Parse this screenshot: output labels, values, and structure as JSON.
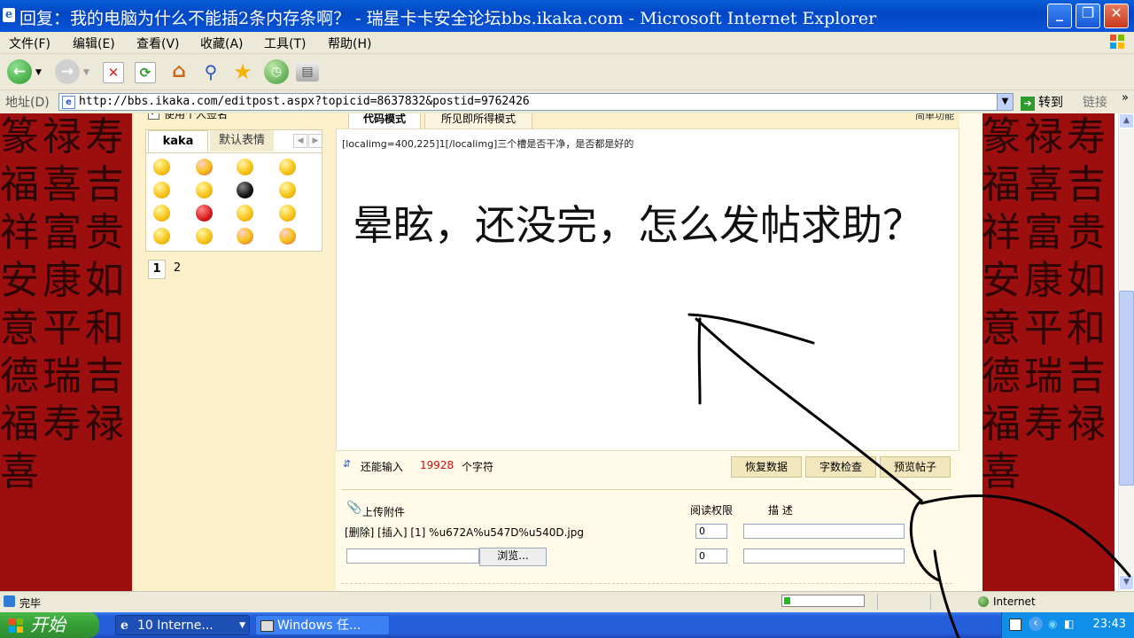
{
  "window": {
    "title": "回复：我的电脑为什么不能插2条内存条啊？ - 瑞星卡卡安全论坛bbs.ikaka.com - Microsoft Internet Explorer",
    "minimize": "_",
    "maximize": "❐",
    "close": "✕",
    "ie_icon": "e"
  },
  "menu": [
    "文件(F)",
    "编辑(E)",
    "查看(V)",
    "收藏(A)",
    "工具(T)",
    "帮助(H)"
  ],
  "toolbar_icons": [
    "back-icon",
    "forward-icon",
    "stop-icon",
    "refresh-icon",
    "home-icon",
    "search-icon",
    "favorites-icon",
    "history-icon",
    "print-icon"
  ],
  "address": {
    "label": "地址(D)",
    "url": "http://bbs.ikaka.com/editpost.aspx?topicid=8637832&postid=9762426",
    "go": "转到",
    "links": "链接"
  },
  "left_panel": {
    "signature_label": "使用个人签名",
    "tabs": [
      "kaka",
      "默认表情"
    ],
    "pages": [
      "1",
      "2"
    ]
  },
  "editor": {
    "tab_code": "代码模式",
    "tab_wysiwyg": "所见即所得模式",
    "simple_function": "简单功能",
    "code_text": "[localimg=400,225]1[/localimg]三个槽是否干净，是否都是好的",
    "handwritten_text": "晕眩，还没完，怎么发帖求助？",
    "remain_prefix": "还能输入",
    "remain_count": "19928",
    "remain_suffix": "个字符",
    "buttons": [
      "恢复数据",
      "字数检查",
      "预览帖子"
    ]
  },
  "attachments": {
    "title": "上传附件",
    "permission_label": "阅读权限",
    "description_label": "描 述",
    "file_entry": "[删除] [插入] [1] %u672A%u547D%u540D.jpg",
    "permission_values": [
      "0",
      "0"
    ],
    "browse": "浏览..."
  },
  "statusbar": {
    "text": "完毕",
    "progress": 0.08,
    "zone": "Internet"
  },
  "taskbar": {
    "start": "开始",
    "tasks": [
      "10 Interne...",
      "Windows 任..."
    ],
    "clock": "23:43"
  },
  "decor": {
    "seal_glyphs": "篆禄寿福喜吉祥富贵安康如意平和德瑞吉福寿禄喜",
    "colors": {
      "title_blue": "#0046c4",
      "seal_red": "#9d0f0f",
      "page_bg": "#fffbe8"
    }
  }
}
